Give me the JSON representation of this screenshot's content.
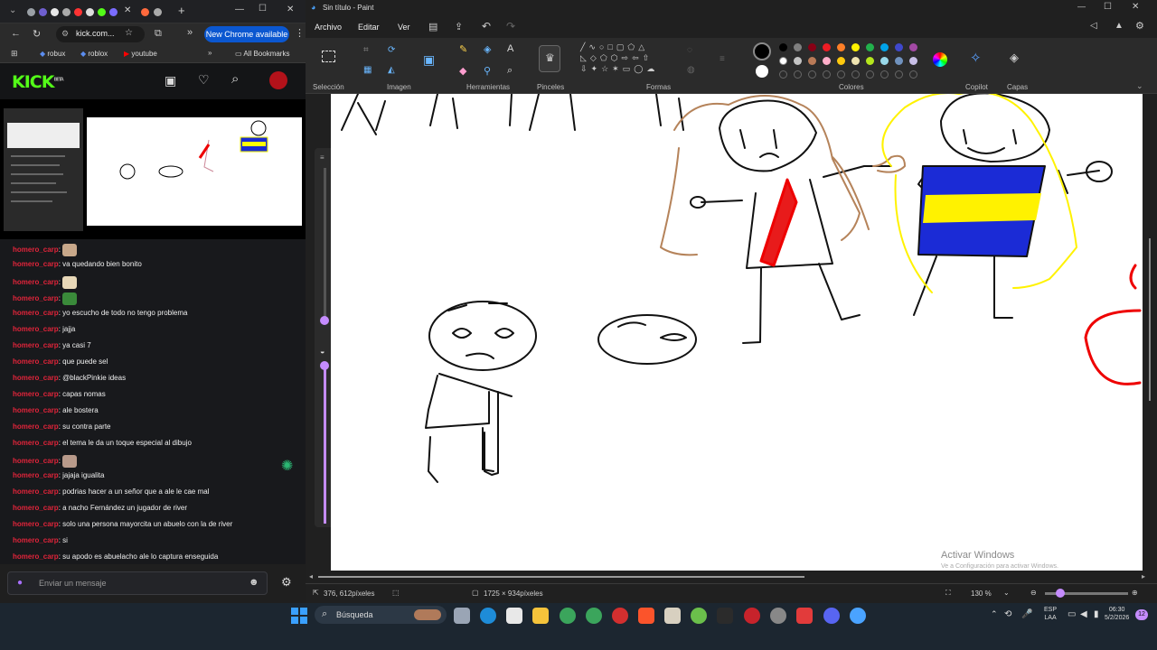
{
  "chrome": {
    "url": "kick.com...",
    "update_label": "New Chrome available",
    "bookmarks": [
      "robux",
      "roblox",
      "youtube"
    ],
    "all_bookmarks": "All Bookmarks"
  },
  "kick": {
    "logo": "KICK",
    "beta": "BETA",
    "chat": [
      {
        "user": "homero_carp",
        "text": "",
        "emote": "#c8a88a"
      },
      {
        "user": "homero_carp",
        "text": ": va quedando bien bonito"
      },
      {
        "user": "homero_carp",
        "text": "",
        "emote": "#e8d8b8"
      },
      {
        "user": "homero_carp",
        "text": "",
        "emote": "#3a8a3a"
      },
      {
        "user": "homero_carp",
        "text": ": yo escucho de todo no tengo problema"
      },
      {
        "user": "homero_carp",
        "text": ": jajja"
      },
      {
        "user": "homero_carp",
        "text": ": ya casi 7"
      },
      {
        "user": "homero_carp",
        "text": ": que puede sel"
      },
      {
        "user": "homero_carp",
        "text": ": @blackPinkie ideas"
      },
      {
        "user": "homero_carp",
        "text": ": capas nomas"
      },
      {
        "user": "homero_carp",
        "text": ": ale bostera"
      },
      {
        "user": "homero_carp",
        "text": ": su contra parte"
      },
      {
        "user": "homero_carp",
        "text": ": el tema le da un toque especial al dibujo"
      },
      {
        "user": "homero_carp",
        "text": "",
        "emote": "#b89a8a"
      },
      {
        "user": "homero_carp",
        "text": ": jajaja igualita"
      },
      {
        "user": "homero_carp",
        "text": ": podrias hacer a un señor que a ale le cae mal"
      },
      {
        "user": "homero_carp",
        "text": ": a nacho Fernández un jugador de river"
      },
      {
        "user": "homero_carp",
        "text": ": solo una persona mayorcita un abuelo con la de river"
      },
      {
        "user": "homero_carp",
        "text": ": si"
      },
      {
        "user": "homero_carp",
        "text": ": su apodo es abuelacho ale lo captura enseguida"
      }
    ],
    "input_placeholder": "Enviar un mensaje"
  },
  "paint": {
    "title": "Sin título - Paint",
    "menu": [
      "Archivo",
      "Editar",
      "Ver"
    ],
    "groups": [
      "Selección",
      "Imagen",
      "Herramientas",
      "Pinceles",
      "Formas",
      "Colores",
      "Copilot",
      "Capas"
    ],
    "status_pos": "376, 612píxeles",
    "status_size": "1725 × 934píxeles",
    "zoom": "130 %",
    "watermark_title": "Activar Windows",
    "watermark_sub": "Ve a Configuración para activar Windows.",
    "palette": [
      "#000000",
      "#7f7f7f",
      "#880015",
      "#ed1c24",
      "#ff7f27",
      "#fff200",
      "#22b14c",
      "#00a2e8",
      "#3f48cc",
      "#a349a4",
      "#ffffff",
      "#c3c3c3",
      "#b97a57",
      "#ffaec9",
      "#ffc90e",
      "#efe4b0",
      "#b5e61d",
      "#99d9ea",
      "#7092be",
      "#c8bfe7"
    ]
  },
  "taskbar": {
    "search": "Búsqueda",
    "lang1": "ESP",
    "lang2": "LAA",
    "time": "06:30",
    "date": "5/2/2026",
    "badge": "12"
  }
}
